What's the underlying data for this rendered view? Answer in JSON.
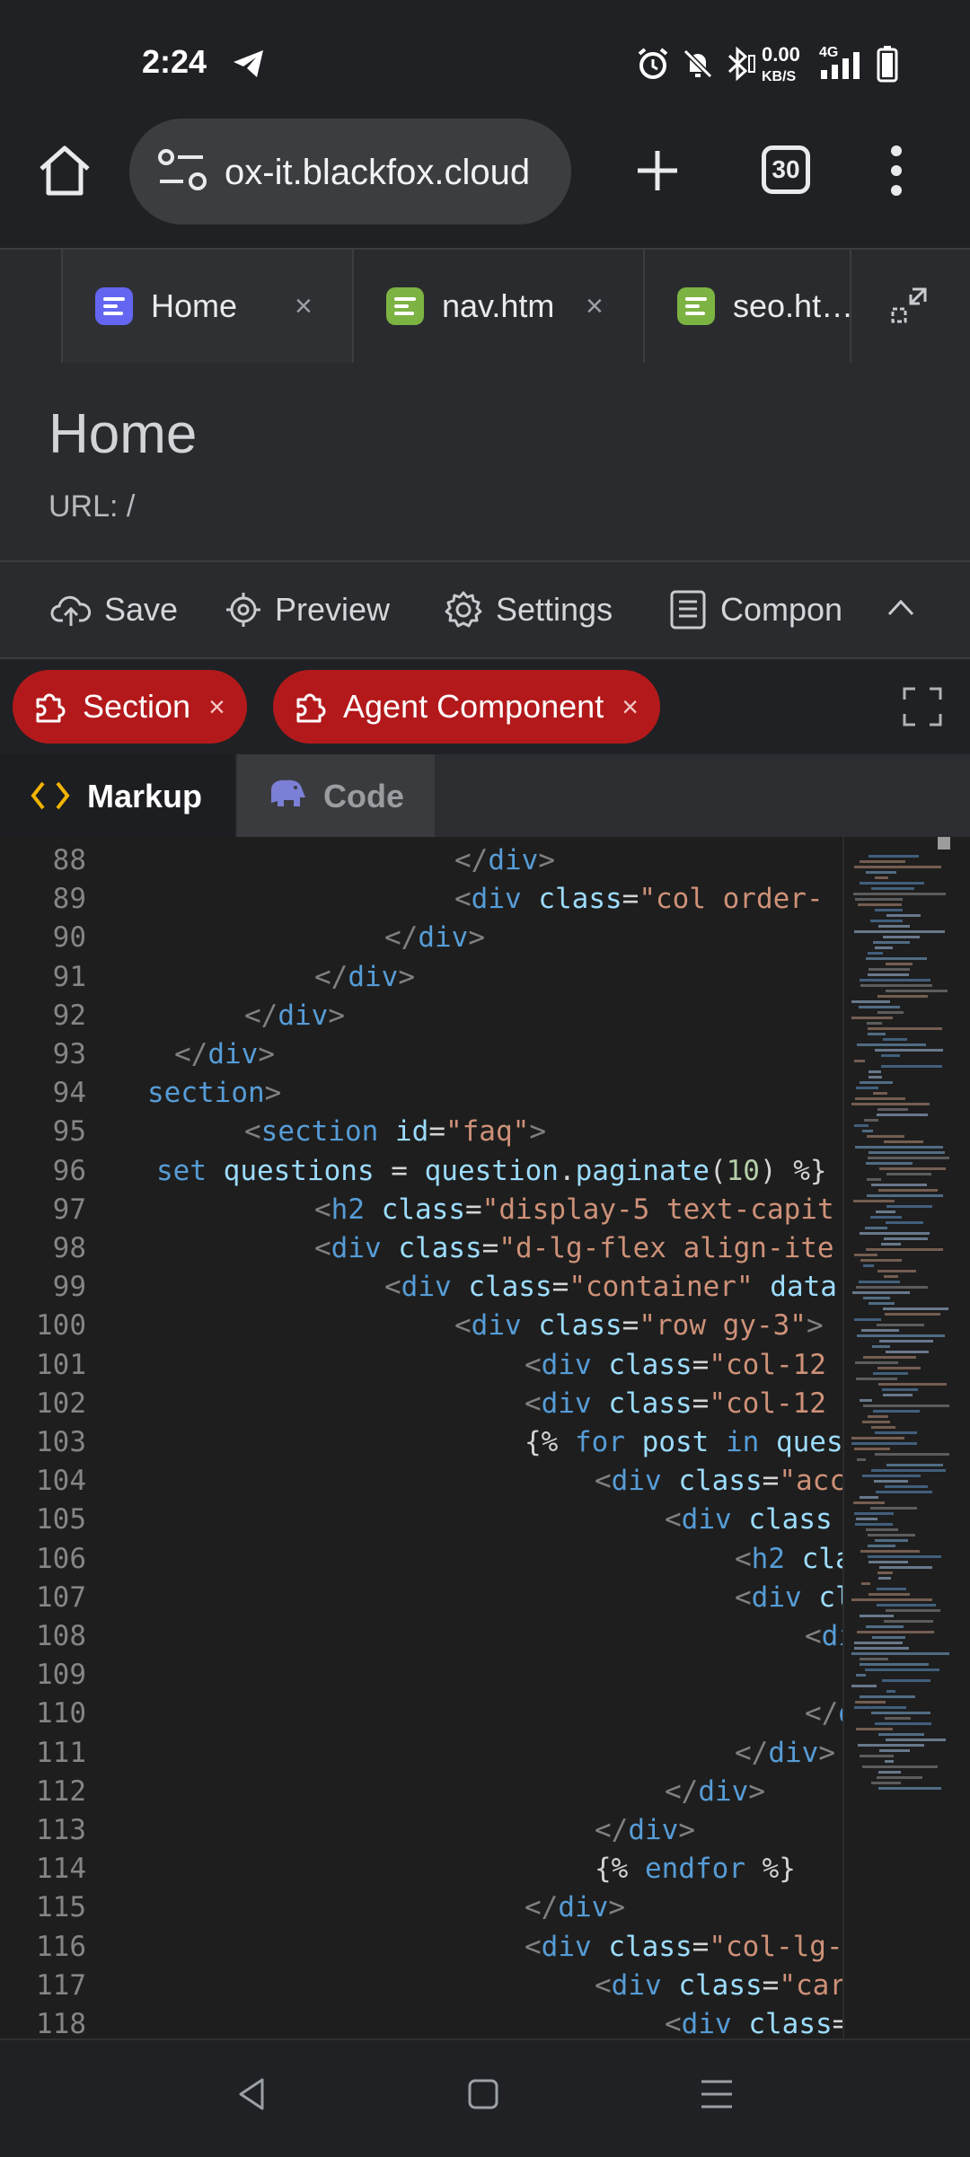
{
  "status_bar": {
    "time": "2:24",
    "net_speed": "0.00",
    "net_unit": "KB/S",
    "net_type": "4G",
    "icons": [
      "telegram-icon",
      "alarm-icon",
      "mute-icon",
      "bluetooth-icon",
      "signal-icon",
      "battery-icon"
    ]
  },
  "browser": {
    "url": "ox-it.blackfox.cloud",
    "tab_count": "30"
  },
  "tabs": [
    {
      "label": "Home",
      "close": "×"
    },
    {
      "label": "nav.htm",
      "close": "×"
    },
    {
      "label": "seo.ht…"
    }
  ],
  "page": {
    "title": "Home",
    "url_label": "URL: /"
  },
  "toolbar": {
    "save": "Save",
    "preview": "Preview",
    "settings": "Settings",
    "components": "Compon"
  },
  "chips": [
    {
      "label": "Section",
      "close": "×"
    },
    {
      "label": "Agent Component",
      "close": "×"
    }
  ],
  "editor_tabs": {
    "markup": "Markup",
    "code": "Code"
  },
  "colors": {
    "chip_red": "#b3191b",
    "code_bg": "#1e1e1e",
    "tag_blue": "#569cd6",
    "attr_blue": "#9cdcfe",
    "string_orange": "#ce9178"
  },
  "code_lines": [
    {
      "n": "88",
      "parts": [
        [
          "brk",
          "</"
        ],
        [
          "tag",
          "div"
        ],
        [
          "brk",
          ">"
        ]
      ]
    },
    {
      "n": "89",
      "parts": [
        [
          "brk",
          "<"
        ],
        [
          "tag",
          "div "
        ],
        [
          "attr",
          "class"
        ],
        [
          "txt",
          "="
        ],
        [
          "str",
          "\"col order-"
        ]
      ]
    },
    {
      "n": "90",
      "parts": [
        [
          "brk",
          "</"
        ],
        [
          "tag",
          "div"
        ],
        [
          "brk",
          ">"
        ]
      ]
    },
    {
      "n": "91",
      "parts": [
        [
          "brk",
          "</"
        ],
        [
          "tag",
          "div"
        ],
        [
          "brk",
          ">"
        ]
      ]
    },
    {
      "n": "92",
      "parts": [
        [
          "brk",
          "</"
        ],
        [
          "tag",
          "div"
        ],
        [
          "brk",
          ">"
        ]
      ]
    },
    {
      "n": "93",
      "parts": [
        [
          "brk",
          "</"
        ],
        [
          "tag",
          "div"
        ],
        [
          "brk",
          ">"
        ]
      ]
    },
    {
      "n": "94",
      "parts": [
        [
          "tag",
          "section"
        ],
        [
          "brk",
          ">"
        ]
      ]
    },
    {
      "n": "95",
      "parts": [
        [
          "brk",
          "<"
        ],
        [
          "tag",
          "section "
        ],
        [
          "attr",
          "id"
        ],
        [
          "txt",
          "="
        ],
        [
          "str",
          "\"faq\""
        ],
        [
          "brk",
          ">"
        ]
      ]
    },
    {
      "n": "96",
      "parts": [
        [
          "tag",
          "set "
        ],
        [
          "attr",
          "questions"
        ],
        [
          "txt",
          " = "
        ],
        [
          "attr",
          "question"
        ],
        [
          "txt",
          "."
        ],
        [
          "attr",
          "paginate"
        ],
        [
          "txt",
          "("
        ],
        [
          "num",
          "10"
        ],
        [
          "txt",
          ") %}"
        ]
      ]
    },
    {
      "n": "97",
      "parts": [
        [
          "brk",
          "<"
        ],
        [
          "tag",
          "h2 "
        ],
        [
          "attr",
          "class"
        ],
        [
          "txt",
          "="
        ],
        [
          "str",
          "\"display-5 text-capit"
        ]
      ]
    },
    {
      "n": "98",
      "parts": [
        [
          "brk",
          "<"
        ],
        [
          "tag",
          "div "
        ],
        [
          "attr",
          "class"
        ],
        [
          "txt",
          "="
        ],
        [
          "str",
          "\"d-lg-flex align-ite"
        ]
      ]
    },
    {
      "n": "99",
      "parts": [
        [
          "brk",
          "<"
        ],
        [
          "tag",
          "div "
        ],
        [
          "attr",
          "class"
        ],
        [
          "txt",
          "="
        ],
        [
          "str",
          "\"container\" "
        ],
        [
          "attr",
          "data"
        ]
      ]
    },
    {
      "n": "100",
      "parts": [
        [
          "brk",
          "<"
        ],
        [
          "tag",
          "div "
        ],
        [
          "attr",
          "class"
        ],
        [
          "txt",
          "="
        ],
        [
          "str",
          "\"row gy-3\""
        ],
        [
          "brk",
          ">"
        ]
      ]
    },
    {
      "n": "101",
      "parts": [
        [
          "brk",
          "<"
        ],
        [
          "tag",
          "div "
        ],
        [
          "attr",
          "class"
        ],
        [
          "txt",
          "="
        ],
        [
          "str",
          "\"col-12"
        ]
      ]
    },
    {
      "n": "102",
      "parts": [
        [
          "brk",
          "<"
        ],
        [
          "tag",
          "div "
        ],
        [
          "attr",
          "class"
        ],
        [
          "txt",
          "="
        ],
        [
          "str",
          "\"col-12"
        ]
      ]
    },
    {
      "n": "103",
      "parts": [
        [
          "txt",
          "{% "
        ],
        [
          "tag",
          "for "
        ],
        [
          "attr",
          "post "
        ],
        [
          "tag",
          "in "
        ],
        [
          "attr",
          "ques"
        ]
      ]
    },
    {
      "n": "104",
      "parts": [
        [
          "brk",
          "<"
        ],
        [
          "tag",
          "div "
        ],
        [
          "attr",
          "class"
        ],
        [
          "txt",
          "="
        ],
        [
          "str",
          "\"acc"
        ]
      ]
    },
    {
      "n": "105",
      "parts": [
        [
          "brk",
          "<"
        ],
        [
          "tag",
          "div "
        ],
        [
          "attr",
          "class"
        ]
      ]
    },
    {
      "n": "106",
      "parts": [
        [
          "brk",
          "<"
        ],
        [
          "tag",
          "h2 "
        ],
        [
          "attr",
          "cla"
        ]
      ]
    },
    {
      "n": "107",
      "parts": [
        [
          "brk",
          "<"
        ],
        [
          "tag",
          "div "
        ],
        [
          "attr",
          "cl"
        ]
      ]
    },
    {
      "n": "108",
      "parts": [
        [
          "brk",
          "<"
        ],
        [
          "tag",
          "di"
        ]
      ]
    },
    {
      "n": "109",
      "parts": []
    },
    {
      "n": "110",
      "parts": [
        [
          "brk",
          "</"
        ],
        [
          "tag",
          "d"
        ]
      ]
    },
    {
      "n": "111",
      "parts": [
        [
          "brk",
          "</"
        ],
        [
          "tag",
          "div"
        ],
        [
          "brk",
          ">"
        ]
      ]
    },
    {
      "n": "112",
      "parts": [
        [
          "brk",
          "</"
        ],
        [
          "tag",
          "div"
        ],
        [
          "brk",
          ">"
        ]
      ]
    },
    {
      "n": "113",
      "parts": [
        [
          "brk",
          "</"
        ],
        [
          "tag",
          "div"
        ],
        [
          "brk",
          ">"
        ]
      ]
    },
    {
      "n": "114",
      "parts": [
        [
          "txt",
          "{% "
        ],
        [
          "tag",
          "endfor"
        ],
        [
          "txt",
          " %}"
        ]
      ]
    },
    {
      "n": "115",
      "parts": [
        [
          "brk",
          "</"
        ],
        [
          "tag",
          "div"
        ],
        [
          "brk",
          ">"
        ]
      ]
    },
    {
      "n": "116",
      "parts": [
        [
          "brk",
          "<"
        ],
        [
          "tag",
          "div "
        ],
        [
          "attr",
          "class"
        ],
        [
          "txt",
          "="
        ],
        [
          "str",
          "\"col-lg-"
        ]
      ]
    },
    {
      "n": "117",
      "parts": [
        [
          "brk",
          "<"
        ],
        [
          "tag",
          "div "
        ],
        [
          "attr",
          "class"
        ],
        [
          "txt",
          "="
        ],
        [
          "str",
          "\"car"
        ]
      ]
    },
    {
      "n": "118",
      "parts": [
        [
          "brk",
          "<"
        ],
        [
          "tag",
          "div "
        ],
        [
          "attr",
          "class"
        ],
        [
          "txt",
          "="
        ]
      ]
    }
  ]
}
